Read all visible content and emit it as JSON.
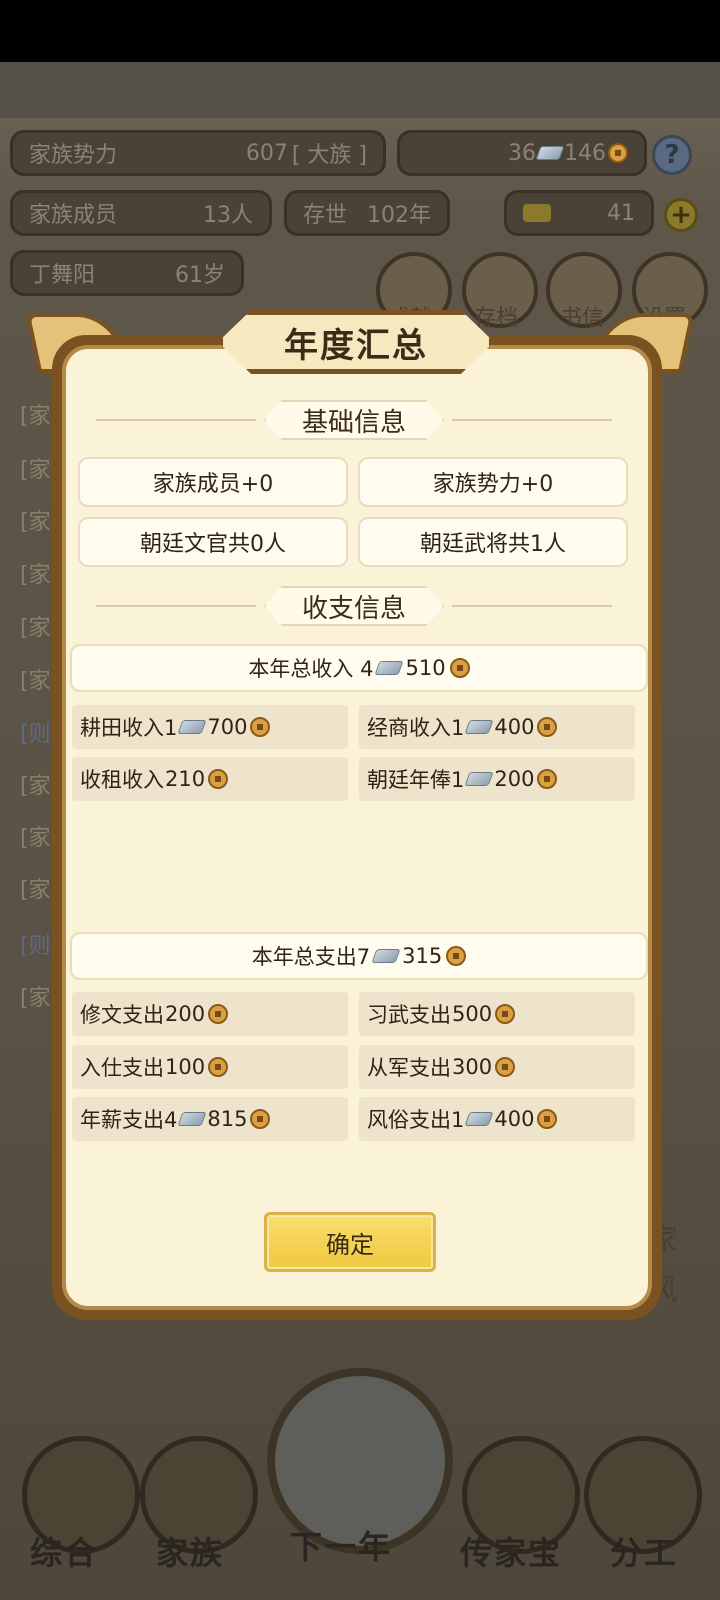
{
  "background": {
    "clan_power_label": "家族势力",
    "clan_power_value": "607",
    "clan_power_rank": "[ 大族 ]",
    "members_label": "家族成员",
    "members_value": "13人",
    "alive_label": "存世",
    "alive_value": "102年",
    "silver_value": "36",
    "copper_value": "146",
    "gold_value": "41",
    "leader_name": "丁舞阳",
    "leader_age": "61岁",
    "help_glyph": "?",
    "plus_glyph": "+",
    "round_buttons": [
      "成就",
      "存档",
      "书信",
      "设置"
    ],
    "side_marks": [
      "[家",
      "[家",
      "[家",
      "[家",
      "[家",
      "[家",
      "[则",
      "[家",
      "[家",
      "[家",
      "[则",
      "[家"
    ],
    "right_side_text": [
      "家",
      "风"
    ],
    "nav": [
      "综合",
      "家族",
      "下一年",
      "传家宝",
      "分工"
    ]
  },
  "dialog": {
    "title": "年度汇总",
    "basic_section": "基础信息",
    "basic": {
      "members": "家族成员+0",
      "power": "家族势力+0",
      "civil": "朝廷文官共0人",
      "military": "朝廷武将共1人"
    },
    "finance_section": "收支信息",
    "income_total": {
      "label": "本年总收入 4",
      "amount": "510"
    },
    "income_items": [
      {
        "label": "耕田收入1",
        "silver": true,
        "amount": "700"
      },
      {
        "label": "经商收入1",
        "silver": true,
        "amount": "400"
      },
      {
        "label": "收租收入",
        "silver": false,
        "amount": "210"
      },
      {
        "label": "朝廷年俸1",
        "silver": true,
        "amount": "200"
      }
    ],
    "expense_total": {
      "label": "本年总支出7",
      "amount": "315"
    },
    "expense_items": [
      {
        "label": "修文支出",
        "silver": false,
        "amount": "200"
      },
      {
        "label": "习武支出",
        "silver": false,
        "amount": "500"
      },
      {
        "label": "入仕支出",
        "silver": false,
        "amount": "100"
      },
      {
        "label": "从军支出",
        "silver": false,
        "amount": "300"
      },
      {
        "label": "年薪支出4",
        "silver": true,
        "amount": "815"
      },
      {
        "label": "风俗支出1",
        "silver": true,
        "amount": "400"
      }
    ],
    "confirm": "确定"
  },
  "icons": {
    "silver": "silver-ingot-icon",
    "copper": "copper-coin-icon"
  }
}
